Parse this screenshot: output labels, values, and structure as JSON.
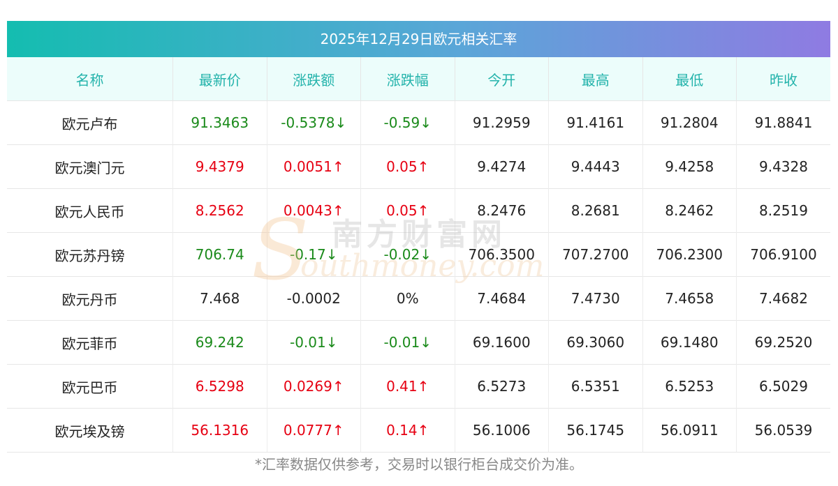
{
  "title": "2025年12月29日欧元相关汇率",
  "columns": [
    "名称",
    "最新价",
    "涨跌额",
    "涨跌幅",
    "今开",
    "最高",
    "最低",
    "昨收"
  ],
  "rows": [
    {
      "name": "欧元卢布",
      "latest": "91.3463",
      "change": "-0.5378↓",
      "pct": "-0.59↓",
      "open": "91.2959",
      "high": "91.4161",
      "low": "91.2804",
      "prev": "91.8841",
      "trend": "down"
    },
    {
      "name": "欧元澳门元",
      "latest": "9.4379",
      "change": "0.0051↑",
      "pct": "0.05↑",
      "open": "9.4274",
      "high": "9.4443",
      "low": "9.4258",
      "prev": "9.4328",
      "trend": "up"
    },
    {
      "name": "欧元人民币",
      "latest": "8.2562",
      "change": "0.0043↑",
      "pct": "0.05↑",
      "open": "8.2476",
      "high": "8.2681",
      "low": "8.2462",
      "prev": "8.2519",
      "trend": "up"
    },
    {
      "name": "欧元苏丹镑",
      "latest": "706.74",
      "change": "-0.17↓",
      "pct": "-0.02↓",
      "open": "706.3500",
      "high": "707.2700",
      "low": "706.2300",
      "prev": "706.9100",
      "trend": "down"
    },
    {
      "name": "欧元丹币",
      "latest": "7.468",
      "change": "-0.0002",
      "pct": "0%",
      "open": "7.4684",
      "high": "7.4730",
      "low": "7.4658",
      "prev": "7.4682",
      "trend": "flat"
    },
    {
      "name": "欧元菲币",
      "latest": "69.242",
      "change": "-0.01↓",
      "pct": "-0.01↓",
      "open": "69.1600",
      "high": "69.3060",
      "low": "69.1480",
      "prev": "69.2520",
      "trend": "down"
    },
    {
      "name": "欧元巴币",
      "latest": "6.5298",
      "change": "0.0269↑",
      "pct": "0.41↑",
      "open": "6.5273",
      "high": "6.5351",
      "low": "6.5253",
      "prev": "6.5029",
      "trend": "up"
    },
    {
      "name": "欧元埃及镑",
      "latest": "56.1316",
      "change": "0.0777↑",
      "pct": "0.14↑",
      "open": "56.1006",
      "high": "56.1745",
      "low": "56.0911",
      "prev": "56.0539",
      "trend": "up"
    }
  ],
  "footer_note": "*汇率数据仅供参考，交易时以银行柜台成交价为准。",
  "watermark": {
    "cn": "南方财富网",
    "en": "outhmoney.com",
    "s": "S"
  },
  "colors": {
    "up": "#e60012",
    "down": "#1a8a1a",
    "header_text": "#23b3ab",
    "title_gradient": [
      "#14bdb0",
      "#8f7be2"
    ]
  }
}
